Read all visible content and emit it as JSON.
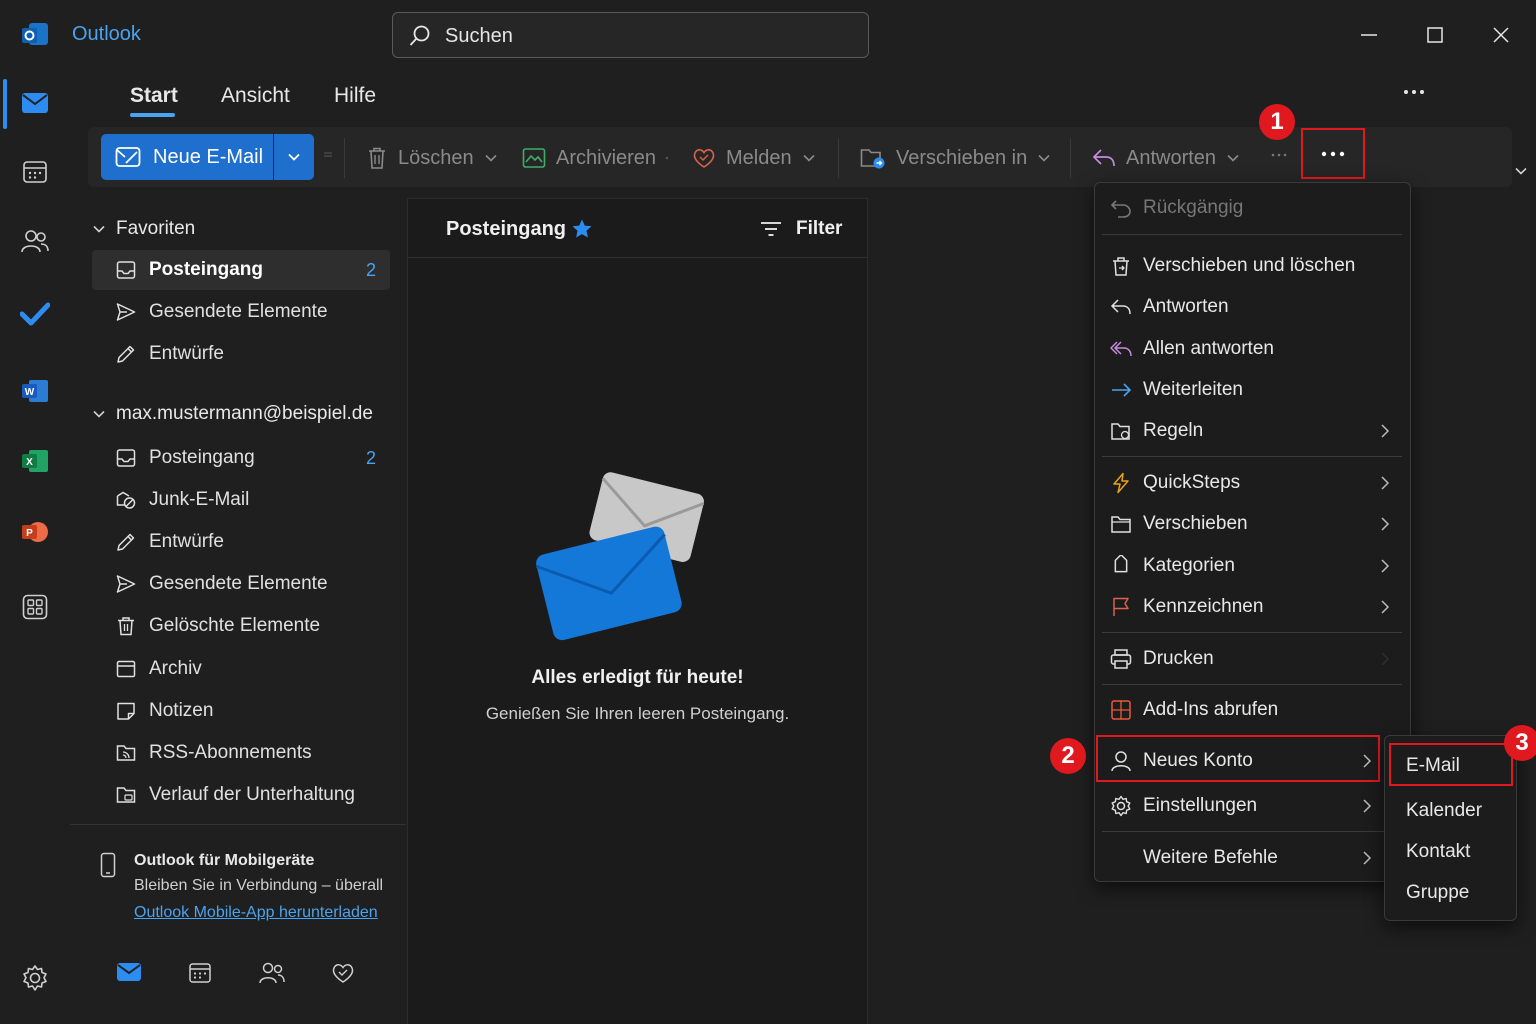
{
  "app": {
    "title": "Outlook"
  },
  "search": {
    "placeholder": "Suchen"
  },
  "tabs": [
    {
      "label": "Start"
    },
    {
      "label": "Ansicht"
    },
    {
      "label": "Hilfe"
    }
  ],
  "ribbon": {
    "new_mail": "Neue E-Mail",
    "delete": "Löschen",
    "archive": "Archivieren",
    "report": "Melden",
    "move_to": "Verschieben in",
    "reply": "Antworten",
    "more": "···"
  },
  "badges": {
    "one": "1",
    "two": "2",
    "three": "3"
  },
  "favorites": {
    "header": "Favoriten",
    "items": [
      {
        "label": "Posteingang",
        "count": "2"
      },
      {
        "label": "Gesendete Elemente"
      },
      {
        "label": "Entwürfe"
      }
    ]
  },
  "account": {
    "header": "max.mustermann@beispiel.de",
    "items": [
      {
        "label": "Posteingang",
        "count": "2"
      },
      {
        "label": "Junk-E-Mail"
      },
      {
        "label": "Entwürfe"
      },
      {
        "label": "Gesendete Elemente"
      },
      {
        "label": "Gelöschte Elemente"
      },
      {
        "label": "Archiv"
      },
      {
        "label": "Notizen"
      },
      {
        "label": "RSS-Abonnements"
      },
      {
        "label": "Verlauf der Unterhaltung"
      }
    ]
  },
  "mobile": {
    "title": "Outlook für Mobilgeräte",
    "desc": "Bleiben Sie in Verbindung – überall",
    "link": "Outlook Mobile-App herunterladen"
  },
  "list": {
    "title": "Posteingang",
    "filter": "Filter",
    "empty_title": "Alles erledigt für heute!",
    "empty_sub": "Genießen Sie Ihren leeren Posteingang."
  },
  "menu": {
    "undo": "Rückgängig",
    "move_delete": "Verschieben und löschen",
    "reply": "Antworten",
    "reply_all": "Allen antworten",
    "forward": "Weiterleiten",
    "rules": "Regeln",
    "quicksteps": "QuickSteps",
    "move": "Verschieben",
    "categories": "Kategorien",
    "flag": "Kennzeichnen",
    "print": "Drucken",
    "addins": "Add-Ins abrufen",
    "new_account": "Neues Konto",
    "settings": "Einstellungen",
    "more_commands": "Weitere Befehle"
  },
  "submenu": {
    "email": "E-Mail",
    "calendar": "Kalender",
    "contact": "Kontakt",
    "group": "Gruppe"
  },
  "colors": {
    "accent": "#1f6fcf",
    "highlight": "#e0191f",
    "link": "#4aa3f0"
  }
}
